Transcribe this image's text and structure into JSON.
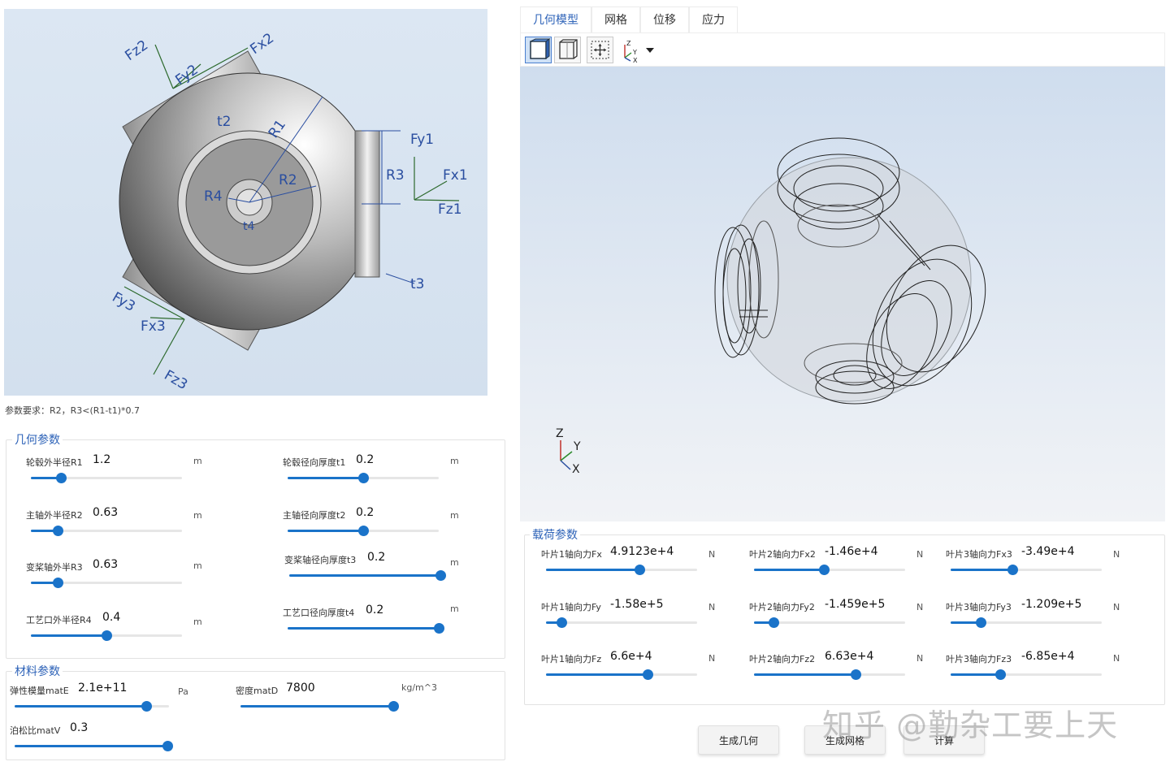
{
  "schematic": {
    "labels": {
      "fx2": "Fx2",
      "fy2": "Fy2",
      "fz2": "Fz2",
      "fx1": "Fx1",
      "fy1": "Fy1",
      "fz1": "Fz1",
      "fx3": "Fx3",
      "fy3": "Fy3",
      "fz3": "Fz3",
      "r1": "R1",
      "r2": "R2",
      "r3": "R3",
      "r4": "R4",
      "t2": "t2",
      "t3": "t3",
      "t4": "t4"
    }
  },
  "requirement_note": "参数要求：R2，R3<(R1-t1)*0.7",
  "geometry": {
    "title": "几何参数",
    "params": [
      {
        "label": "轮毂外半径R1",
        "value": "1.2",
        "unit": "m",
        "level": 0.2
      },
      {
        "label": "轮毂径向厚度t1",
        "value": "0.2",
        "unit": "m",
        "level": 0.5
      },
      {
        "label": "主轴外半径R2",
        "value": "0.63",
        "unit": "m",
        "level": 0.18
      },
      {
        "label": "主轴径向厚度t2",
        "value": "0.2",
        "unit": "m",
        "level": 0.5
      },
      {
        "label": "变桨轴外半R3",
        "value": "0.63",
        "unit": "m",
        "level": 0.18
      },
      {
        "label": "变桨轴径向厚度t3",
        "value": "0.2",
        "unit": "m",
        "level": 1.0
      },
      {
        "label": "工艺口外半径R4",
        "value": "0.4",
        "unit": "m",
        "level": 0.5
      },
      {
        "label": "工艺口径向厚度t4",
        "value": "0.2",
        "unit": "m",
        "level": 1.0
      }
    ]
  },
  "material": {
    "title": "材料参数",
    "params": [
      {
        "label": "弹性模量matE",
        "value": "2.1e+11",
        "unit": "Pa",
        "level": 0.85
      },
      {
        "label": "密度matD",
        "value": "7800",
        "unit": "kg/m^3",
        "level": 1.0
      },
      {
        "label": "泊松比matV",
        "value": "0.3",
        "unit": "",
        "level": 1.0
      }
    ]
  },
  "tabs": [
    {
      "label": "几何模型",
      "active": true
    },
    {
      "label": "网格",
      "active": false
    },
    {
      "label": "位移",
      "active": false
    },
    {
      "label": "应力",
      "active": false
    }
  ],
  "toolbar": {
    "icons": [
      "solid-view-icon",
      "wireframe-view-icon",
      "fit-view-icon",
      "axis-orientation-icon"
    ]
  },
  "viewport": {
    "axis": {
      "z": "Z",
      "y": "Y",
      "x": "X"
    }
  },
  "loads": {
    "title": "载荷参数",
    "params": [
      {
        "label": "叶片1轴向力Fx",
        "value": "4.9123e+4",
        "unit": "N",
        "level": 0.62
      },
      {
        "label": "叶片2轴向力Fx2",
        "value": "-1.46e+4",
        "unit": "N",
        "level": 0.46
      },
      {
        "label": "叶片3轴向力Fx3",
        "value": "-3.49e+4",
        "unit": "N",
        "level": 0.41
      },
      {
        "label": "叶片1轴向力Fy",
        "value": "-1.58e+5",
        "unit": "N",
        "level": 0.1
      },
      {
        "label": "叶片2轴向力Fy2",
        "value": "-1.459e+5",
        "unit": "N",
        "level": 0.13
      },
      {
        "label": "叶片3轴向力Fy3",
        "value": "-1.209e+5",
        "unit": "N",
        "level": 0.2
      },
      {
        "label": "叶片1轴向力Fz",
        "value": "6.6e+4",
        "unit": "N",
        "level": 0.67
      },
      {
        "label": "叶片2轴向力Fz2",
        "value": "6.63e+4",
        "unit": "N",
        "level": 0.67
      },
      {
        "label": "叶片3轴向力Fz3",
        "value": "-6.85e+4",
        "unit": "N",
        "level": 0.33
      }
    ]
  },
  "buttons": {
    "gen_geometry": "生成几何",
    "gen_mesh": "生成网格",
    "compute": "计算"
  },
  "watermark": "知乎 @勤杂工要上天",
  "colors": {
    "accent": "#1a73c9",
    "title": "#2e63b8",
    "label": "#2a4ea0"
  }
}
